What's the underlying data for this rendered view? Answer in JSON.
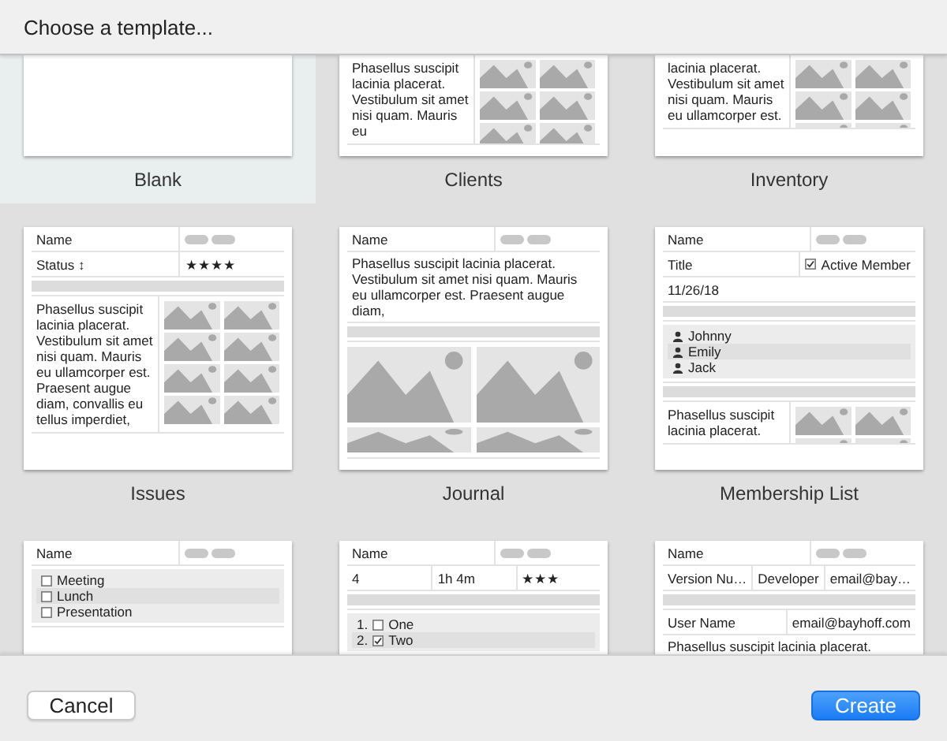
{
  "dialog": {
    "title": "Choose a template..."
  },
  "templates": [
    {
      "name": "Blank",
      "selected": true
    },
    {
      "name": "Clients",
      "selected": false,
      "preview": [
        {
          "kind": "text_images",
          "text": "Phasellus suscipit lacinia placerat. Vestibulum sit amet nisi quam. Mauris eu"
        }
      ]
    },
    {
      "name": "Inventory",
      "selected": false,
      "preview": [
        {
          "kind": "text_images",
          "text": "lacinia placerat. Vestibulum sit amet nisi quam. Mauris eu ullamcorper est."
        }
      ]
    },
    {
      "name": "Issues",
      "selected": false,
      "preview": [
        {
          "kind": "fields",
          "cells": [
            {
              "kind": "text",
              "text": "Name"
            },
            {
              "kind": "pills"
            }
          ]
        },
        {
          "kind": "fields",
          "cells": [
            {
              "kind": "text",
              "text": "Status ↕"
            },
            {
              "kind": "text",
              "text": "★★★★"
            }
          ]
        },
        {
          "kind": "bar"
        },
        {
          "kind": "text_images",
          "text": "Phasellus suscipit lacinia placerat. Vestibulum sit amet nisi quam. Mauris eu ullamcorper est. Praesent augue diam, convallis eu tellus imperdiet,"
        }
      ]
    },
    {
      "name": "Journal",
      "selected": false,
      "preview": [
        {
          "kind": "fields",
          "cells": [
            {
              "kind": "text",
              "text": "Name"
            },
            {
              "kind": "pills"
            }
          ]
        },
        {
          "kind": "text",
          "text": "Phasellus suscipit lacinia placerat. Vestibulum sit amet nisi quam. Mauris eu ullamcorper est. Praesent augue diam,"
        },
        {
          "kind": "bar"
        },
        {
          "kind": "images"
        }
      ]
    },
    {
      "name": "Membership List",
      "selected": false,
      "preview": [
        {
          "kind": "fields",
          "cells": [
            {
              "kind": "text",
              "text": "Name"
            },
            {
              "kind": "pills"
            }
          ]
        },
        {
          "kind": "fields",
          "cells": [
            {
              "kind": "text",
              "text": "Title"
            },
            {
              "kind": "checkbox",
              "checked": true,
              "text": "Active Member"
            }
          ]
        },
        {
          "kind": "fields",
          "cells": [
            {
              "kind": "text",
              "text": "11/26/18"
            }
          ]
        },
        {
          "kind": "bar"
        },
        {
          "kind": "list",
          "items": [
            {
              "kind": "person",
              "text": "Johnny"
            },
            {
              "kind": "person",
              "text": "Emily"
            },
            {
              "kind": "person",
              "text": "Jack"
            }
          ]
        },
        {
          "kind": "bar"
        },
        {
          "kind": "text_images",
          "text": "Phasellus suscipit lacinia placerat."
        }
      ]
    },
    {
      "selected": false,
      "preview": [
        {
          "kind": "fields",
          "cells": [
            {
              "kind": "text",
              "text": "Name"
            },
            {
              "kind": "pills"
            }
          ]
        },
        {
          "kind": "list",
          "items": [
            {
              "kind": "checkbox",
              "checked": false,
              "text": "Meeting"
            },
            {
              "kind": "checkbox",
              "checked": false,
              "text": "Lunch"
            },
            {
              "kind": "checkbox",
              "checked": false,
              "text": "Presentation"
            }
          ]
        }
      ]
    },
    {
      "selected": false,
      "preview": [
        {
          "kind": "fields",
          "cells": [
            {
              "kind": "text",
              "text": "Name"
            },
            {
              "kind": "pills"
            }
          ]
        },
        {
          "kind": "fields",
          "cells": [
            {
              "kind": "text",
              "text": "4"
            },
            {
              "kind": "text",
              "text": "1h 4m"
            },
            {
              "kind": "text",
              "text": "★★★"
            }
          ]
        },
        {
          "kind": "bar"
        },
        {
          "kind": "list",
          "items": [
            {
              "kind": "checkbox",
              "number": "1.",
              "checked": false,
              "text": "One"
            },
            {
              "kind": "checkbox",
              "number": "2.",
              "checked": true,
              "text": "Two"
            }
          ]
        }
      ]
    },
    {
      "selected": false,
      "preview": [
        {
          "kind": "fields",
          "cells": [
            {
              "kind": "text",
              "text": "Name"
            },
            {
              "kind": "pills"
            }
          ]
        },
        {
          "kind": "fields",
          "cells": [
            {
              "kind": "text",
              "text": "Version Nu…"
            },
            {
              "kind": "text",
              "text": "Developer"
            },
            {
              "kind": "text",
              "text": "email@bay…"
            }
          ]
        },
        {
          "kind": "bar"
        },
        {
          "kind": "fields",
          "cells": [
            {
              "kind": "text",
              "text": "User Name"
            },
            {
              "kind": "text",
              "text": "email@bayhoff.com"
            }
          ]
        },
        {
          "kind": "text",
          "text": "Phasellus suscipit lacinia placerat."
        }
      ]
    }
  ],
  "buttons": [
    {
      "label": "Cancel",
      "kind": "secondary"
    },
    {
      "label": "Create",
      "kind": "primary"
    }
  ]
}
